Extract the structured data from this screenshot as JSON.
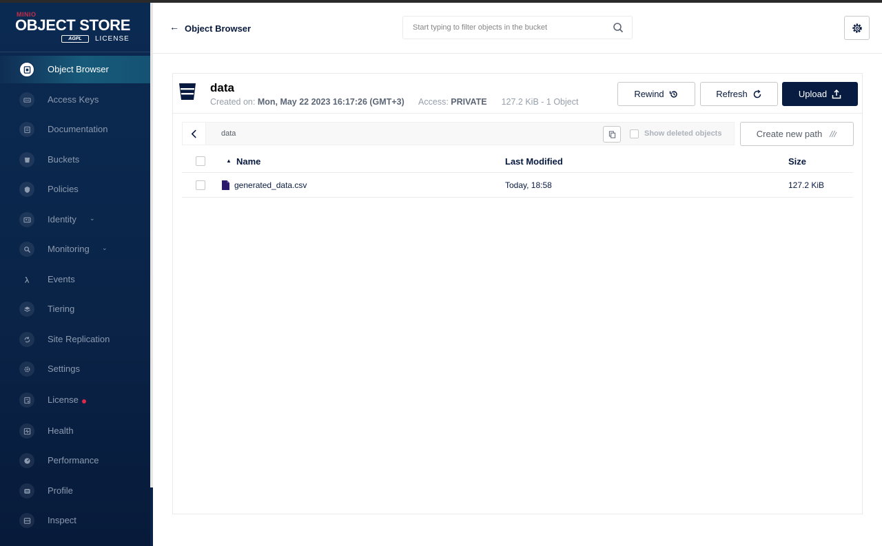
{
  "sidebar": {
    "logo": {
      "brand": "MINIO",
      "product": "OBJECT STORE",
      "badge": "AGPL",
      "license": "LICENSE"
    },
    "items": [
      {
        "label": "Object Browser",
        "icon": "object-browser-icon",
        "active": true
      },
      {
        "label": "Access Keys",
        "icon": "access-keys-icon"
      },
      {
        "label": "Documentation",
        "icon": "documentation-icon"
      },
      {
        "label": "Buckets",
        "icon": "buckets-icon"
      },
      {
        "label": "Policies",
        "icon": "policies-icon"
      },
      {
        "label": "Identity",
        "icon": "identity-icon",
        "expandable": true
      },
      {
        "label": "Monitoring",
        "icon": "monitoring-icon",
        "expandable": true
      },
      {
        "label": "Events",
        "icon": "events-icon"
      },
      {
        "label": "Tiering",
        "icon": "tiering-icon"
      },
      {
        "label": "Site Replication",
        "icon": "site-replication-icon"
      },
      {
        "label": "Settings",
        "icon": "settings-icon"
      },
      {
        "label": "License",
        "icon": "license-icon",
        "alert": true
      },
      {
        "label": "Health",
        "icon": "health-icon"
      },
      {
        "label": "Performance",
        "icon": "performance-icon"
      },
      {
        "label": "Profile",
        "icon": "profile-icon"
      },
      {
        "label": "Inspect",
        "icon": "inspect-icon"
      }
    ]
  },
  "header": {
    "title": "Object Browser",
    "search": {
      "placeholder": "Start typing to filter objects in the bucket"
    }
  },
  "bucket": {
    "name": "data",
    "created_label": "Created on:",
    "created_value": "Mon, May 22 2023 16:17:26 (GMT+3)",
    "access_label": "Access:",
    "access_value": "PRIVATE",
    "summary": "127.2 KiB - 1 Object"
  },
  "actions": {
    "rewind": "Rewind",
    "refresh": "Refresh",
    "upload": "Upload"
  },
  "path_bar": {
    "path": "data",
    "show_deleted_label": "Show deleted objects",
    "create_path_label": "Create new path"
  },
  "table": {
    "columns": {
      "name": "Name",
      "last_modified": "Last Modified",
      "size": "Size"
    },
    "rows": [
      {
        "name": "generated_data.csv",
        "last_modified": "Today, 18:58",
        "size": "127.2 KiB"
      }
    ]
  },
  "colors": {
    "sidebar_bg": "#0a2448",
    "primary_button": "#081c42",
    "alert_dot": "#e0294a",
    "file_icon": "#2b1a6b"
  }
}
